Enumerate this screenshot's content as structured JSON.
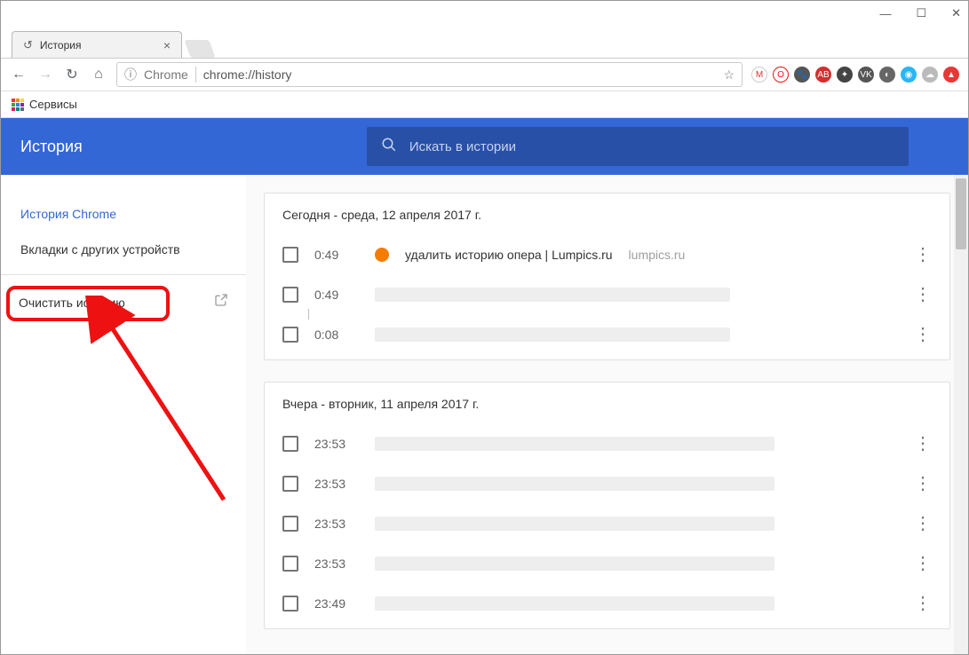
{
  "window": {
    "minimize": "—",
    "maximize": "☐",
    "close": "✕"
  },
  "tab": {
    "title": "История",
    "icon_name": "history-icon"
  },
  "url_bar": {
    "protocol_label": "Chrome",
    "url": "chrome://history",
    "info_icon": "ⓘ"
  },
  "bookmarks": {
    "apps_label": "Сервисы"
  },
  "header": {
    "title": "История"
  },
  "search": {
    "placeholder": "Искать в истории"
  },
  "sidebar": {
    "history_chrome": "История Chrome",
    "other_devices": "Вкладки с других устройств",
    "clear_history": "Очистить историю"
  },
  "sections": [
    {
      "heading": "Сегодня - среда, 12 апреля 2017 г.",
      "entries": [
        {
          "time": "0:49",
          "title": "удалить историю опера | Lumpics.ru",
          "domain": "lumpics.ru",
          "favicon": "orange"
        },
        {
          "time": "0:49",
          "blurred": true
        },
        {
          "time": "0:08",
          "blurred": true
        }
      ]
    },
    {
      "heading": "Вчера - вторник, 11 апреля 2017 г.",
      "entries": [
        {
          "time": "23:53",
          "blurred": true
        },
        {
          "time": "23:53",
          "blurred": true
        },
        {
          "time": "23:53",
          "blurred": true
        },
        {
          "time": "23:53",
          "blurred": true
        },
        {
          "time": "23:49",
          "blurred": true
        }
      ]
    }
  ]
}
